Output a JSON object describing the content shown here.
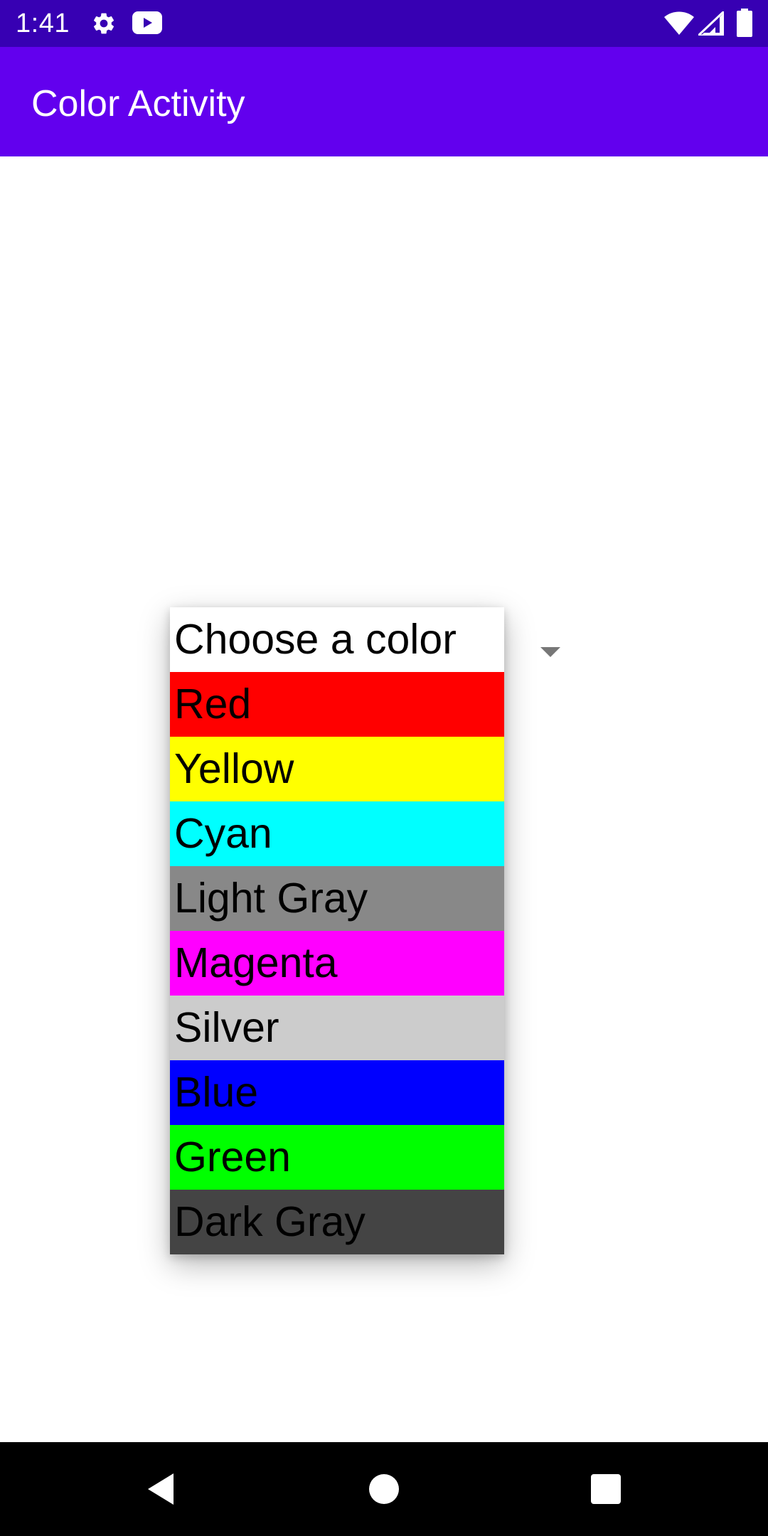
{
  "status_bar": {
    "time": "1:41",
    "icons": [
      "settings-icon",
      "youtube-icon",
      "wifi-icon",
      "signal-icon",
      "battery-icon"
    ]
  },
  "app_bar": {
    "title": "Color Activity"
  },
  "spinner": {
    "prompt": "Choose a color",
    "items": [
      {
        "label": "Red",
        "color": "#ff0000"
      },
      {
        "label": "Yellow",
        "color": "#ffff00"
      },
      {
        "label": "Cyan",
        "color": "#00ffff"
      },
      {
        "label": "Light Gray",
        "color": "#888888"
      },
      {
        "label": "Magenta",
        "color": "#ff00ff"
      },
      {
        "label": "Silver",
        "color": "#cccccc"
      },
      {
        "label": "Blue",
        "color": "#0000ff"
      },
      {
        "label": "Green",
        "color": "#00ff00"
      },
      {
        "label": "Dark Gray",
        "color": "#444444"
      }
    ]
  },
  "colors": {
    "status_bar": "#3700b3",
    "app_bar": "#6200ee",
    "nav_bar": "#000000"
  }
}
